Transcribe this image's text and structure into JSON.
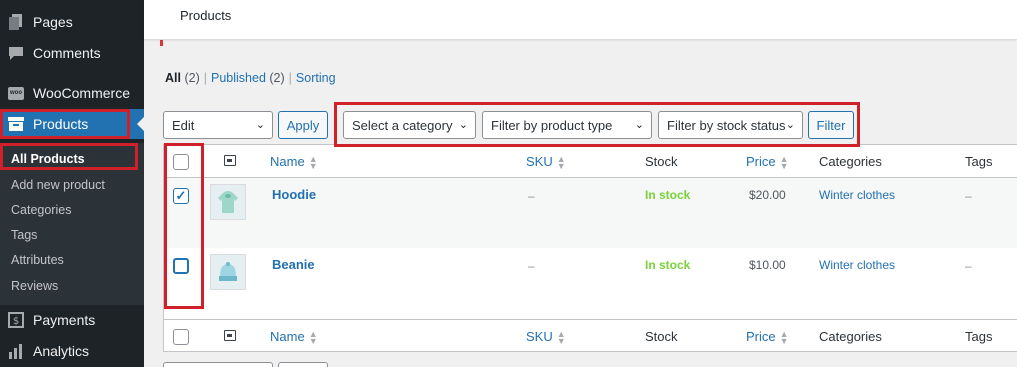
{
  "sidebar": {
    "items": [
      {
        "label": "Pages",
        "icon": "pages-icon"
      },
      {
        "label": "Comments",
        "icon": "comments-icon"
      },
      {
        "label": "WooCommerce",
        "icon": "woocommerce-icon",
        "icon_text": "woo"
      },
      {
        "label": "Products",
        "icon": "products-icon"
      },
      {
        "label": "Payments",
        "icon": "payments-icon"
      },
      {
        "label": "Analytics",
        "icon": "analytics-icon"
      }
    ],
    "submenu": [
      "All Products",
      "Add new product",
      "Categories",
      "Tags",
      "Attributes",
      "Reviews"
    ]
  },
  "header": {
    "title": "Products"
  },
  "views": {
    "all": "All",
    "all_count": "(2)",
    "published": "Published",
    "published_count": "(2)",
    "sorting": "Sorting",
    "separator": "|"
  },
  "bulk_actions": {
    "selected": "Edit",
    "apply_label": "Apply"
  },
  "filters": {
    "category": "Select a category",
    "product_type": "Filter by product type",
    "stock_status": "Filter by stock status",
    "filter_label": "Filter"
  },
  "table": {
    "columns": {
      "name": "Name",
      "sku": "SKU",
      "stock": "Stock",
      "price": "Price",
      "categories": "Categories",
      "tags": "Tags"
    },
    "rows": [
      {
        "name": "Hoodie",
        "sku": "–",
        "stock": "In stock",
        "price": "$20.00",
        "categories": "Winter clothes",
        "tags": "–",
        "checked": true
      },
      {
        "name": "Beanie",
        "sku": "–",
        "stock": "In stock",
        "price": "$10.00",
        "categories": "Winter clothes",
        "tags": "–",
        "checked": false
      }
    ]
  },
  "colors": {
    "accent": "#2271b1",
    "sidebar_bg": "#1d2327",
    "in_stock": "#7ad03a",
    "annotation": "#d0212b"
  }
}
